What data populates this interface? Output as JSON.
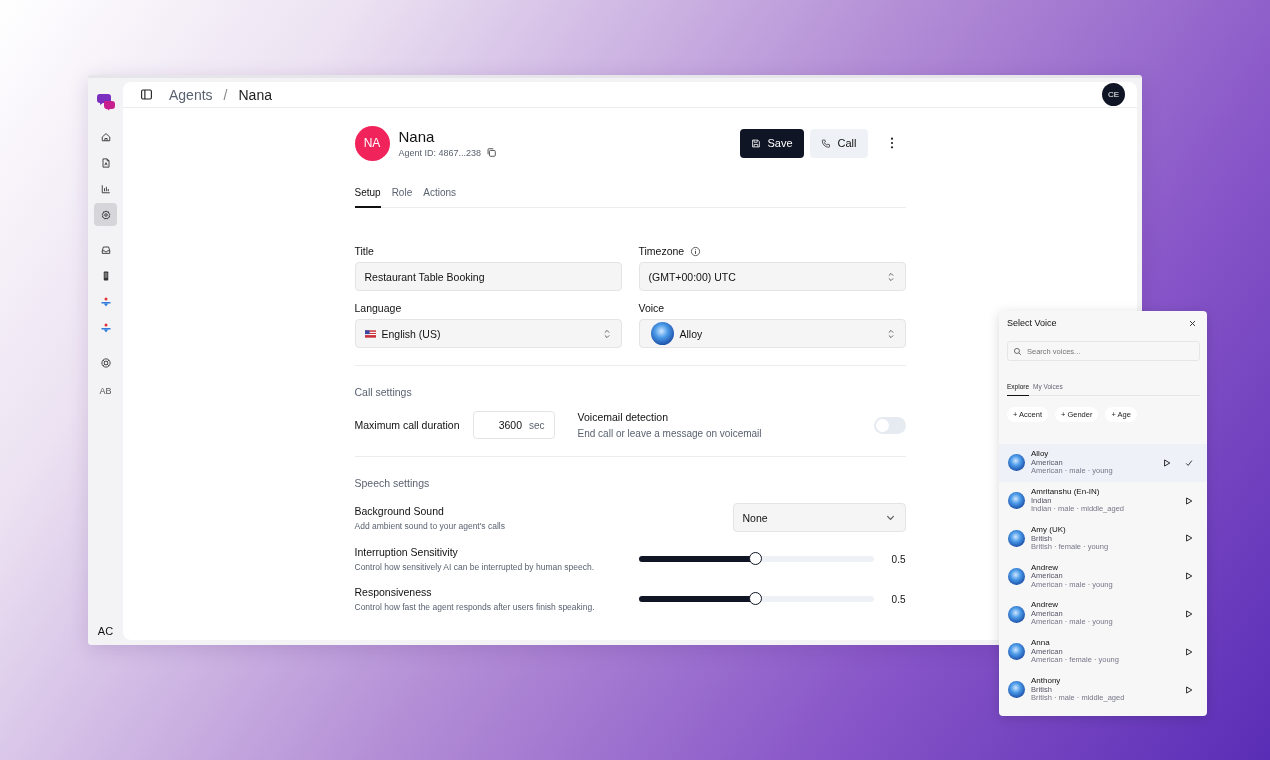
{
  "sidebar": {
    "groups": [
      {
        "items": [
          {
            "selected": false
          },
          {
            "selected": false
          },
          {
            "selected": false
          },
          {
            "selected": true
          }
        ]
      },
      {
        "items": [
          {
            "selected": false
          },
          {
            "selected": false
          },
          {
            "selected": false
          },
          {
            "selected": false
          }
        ]
      },
      {
        "items": [
          {
            "selected": false
          }
        ]
      }
    ],
    "workspace": "AB",
    "user": "AC"
  },
  "breadcrumb": [
    "Agents",
    "Nana"
  ],
  "breadcrumb_separator": "/",
  "account": "CE",
  "agent": {
    "initials": "NA",
    "name": "Nana",
    "id_label": "Agent ID: 4867...238"
  },
  "actions": {
    "save": "Save",
    "call": "Call"
  },
  "tabs": [
    {
      "label": "Setup",
      "selected": true
    },
    {
      "label": "Role",
      "selected": false
    },
    {
      "label": "Actions",
      "selected": false
    }
  ],
  "fields": {
    "title": {
      "label": "Title",
      "value": "Restaurant Table Booking"
    },
    "timezone": {
      "label": "Timezone",
      "value": "(GMT+00:00) UTC"
    },
    "language": {
      "label": "Language",
      "value": "English (US)"
    },
    "voice": {
      "label": "Voice",
      "value": "Alloy"
    }
  },
  "call_settings": {
    "heading": "Call settings",
    "duration_label": "Maximum call duration",
    "duration": "3600",
    "unit": "sec",
    "voicemail": {
      "title": "Voicemail detection",
      "description": "End call or leave a message on voicemail",
      "on": false
    }
  },
  "speech_settings": {
    "heading": "Speech settings",
    "background": {
      "title": "Background Sound",
      "description": "Add ambient sound to your agent's calls",
      "value": "None"
    },
    "sliders": [
      {
        "title": "Interruption Sensitivity",
        "description": "Control how sensitively AI can be interrupted by human speech.",
        "level": 0.5,
        "reading": "0.5"
      },
      {
        "title": "Responsiveness",
        "description": "Control how fast the agent responds after users finish speaking.",
        "level": 0.5,
        "reading": "0.5"
      }
    ]
  },
  "voice_picker": {
    "title": "Select Voice",
    "search_placeholder": "Search voices...",
    "tabs": [
      {
        "label": "Explore",
        "selected": true
      },
      {
        "label": "My Voices",
        "selected": false
      }
    ],
    "filters": [
      "+ Accent",
      "+ Gender",
      "+ Age"
    ],
    "voices": [
      {
        "name": "Alloy",
        "accent": "American",
        "tags": "American · male · young",
        "selected": true
      },
      {
        "name": "Amritanshu (En-IN)",
        "accent": "Indian",
        "tags": "Indian · male · middle_aged",
        "selected": false
      },
      {
        "name": "Amy (UK)",
        "accent": "British",
        "tags": "British · female · young",
        "selected": false
      },
      {
        "name": "Andrew",
        "accent": "American",
        "tags": "American · male · young",
        "selected": false
      },
      {
        "name": "Andrew",
        "accent": "American",
        "tags": "American · male · young",
        "selected": false
      },
      {
        "name": "Anna",
        "accent": "American",
        "tags": "American · female · young",
        "selected": false
      },
      {
        "name": "Anthony",
        "accent": "British",
        "tags": "British · male · middle_aged",
        "selected": false
      }
    ]
  }
}
